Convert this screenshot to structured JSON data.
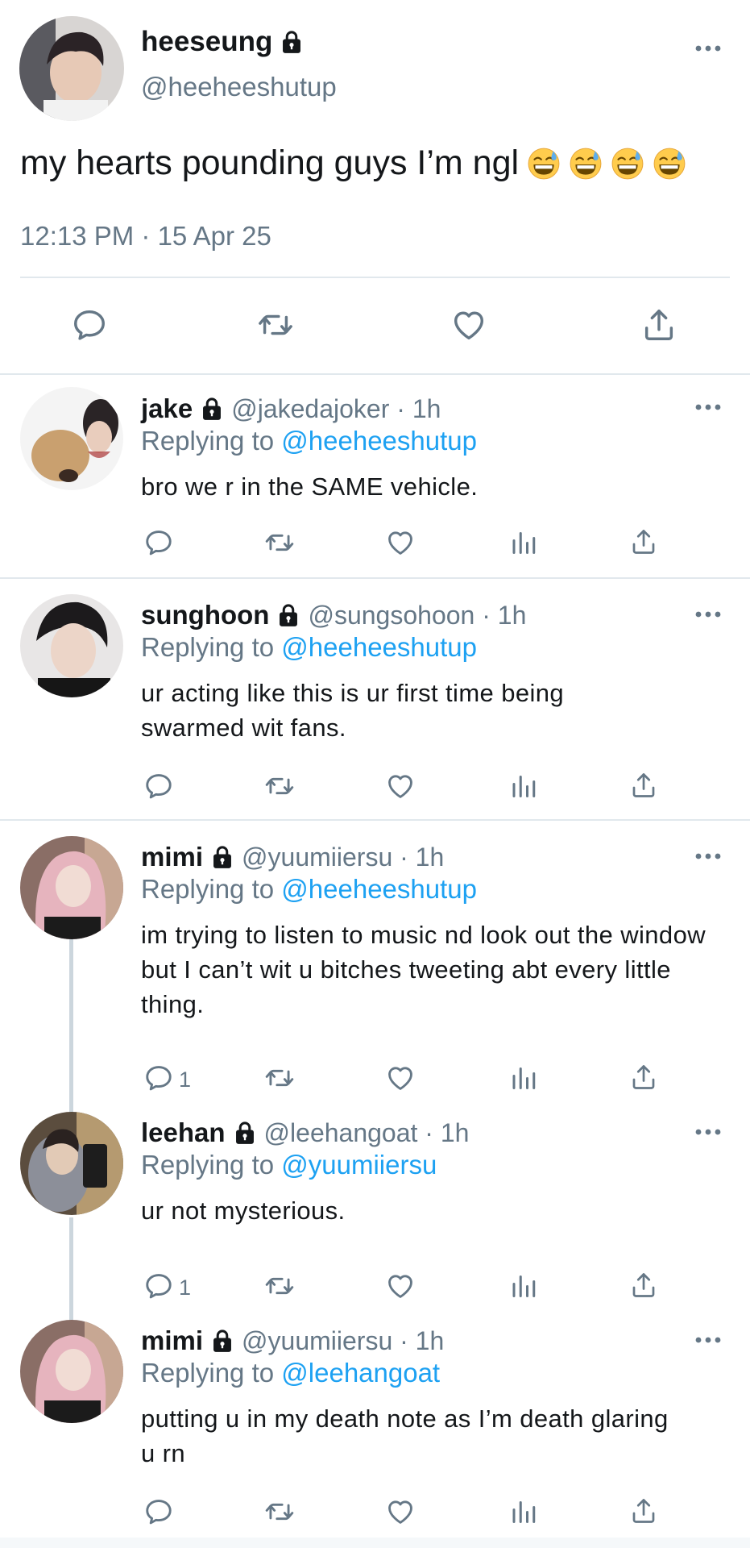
{
  "main_tweet": {
    "display_name": "heeseung",
    "handle": "@heeheeshutup",
    "text": "my hearts pounding guys I’m ngl",
    "emojis": [
      "grinning-sweat-emoji",
      "grinning-sweat-emoji",
      "grinning-sweat-emoji",
      "grinning-sweat-emoji"
    ],
    "timestamp": "12:13 PM · 15 Apr 25",
    "icons": [
      "reply-icon",
      "retweet-icon",
      "like-icon",
      "share-icon"
    ]
  },
  "replies": [
    {
      "display_name": "jake",
      "meta": "@jakedajoker · 1h",
      "replying_prefix": "Replying to",
      "replying_to": "@heeheeshutup",
      "text": "bro we r in the SAME vehicle.",
      "reply_count": ""
    },
    {
      "display_name": "sunghoon",
      "meta": "@sungsohoon · 1h",
      "replying_prefix": "Replying to",
      "replying_to": "@heeheeshutup",
      "text": "ur acting like this is ur first time being swarmed wit fans.",
      "reply_count": ""
    },
    {
      "display_name": "mimi",
      "meta": "@yuumiiersu · 1h",
      "replying_prefix": "Replying to",
      "replying_to": "@heeheeshutup",
      "text": "im trying to listen to music nd look out the window but I can’t wit u bitches tweeting abt every little thing.",
      "reply_count": "1"
    },
    {
      "display_name": "leehan",
      "meta": "@leehangoat · 1h",
      "replying_prefix": "Replying to",
      "replying_to": "@yuumiiersu",
      "text": "ur not mysterious.",
      "reply_count": "1"
    },
    {
      "display_name": "mimi",
      "meta": "@yuumiiersu · 1h",
      "replying_prefix": "Replying to",
      "replying_to": "@leehangoat",
      "text": "putting u in my death note as I’m death glaring u rn",
      "reply_count": ""
    }
  ],
  "colors": {
    "text": "#14171a",
    "secondary": "#657786",
    "link": "#1da1f2",
    "divider": "#e1e8ed"
  }
}
